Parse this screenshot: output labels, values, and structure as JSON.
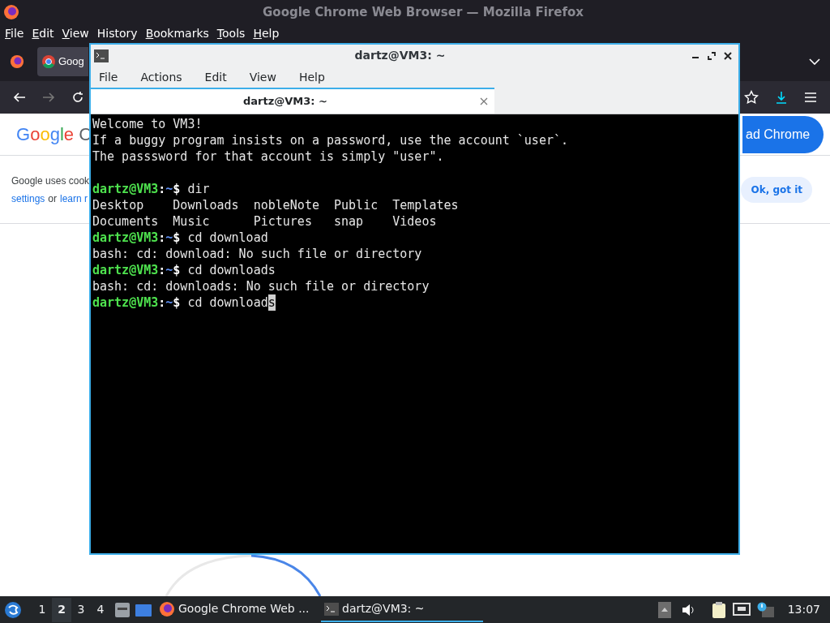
{
  "browser": {
    "title": "Google Chrome Web Browser — Mozilla Firefox",
    "menu": [
      {
        "label": "File",
        "underlined": true
      },
      {
        "label": "Edit",
        "underlined": true
      },
      {
        "label": "View",
        "underlined": true
      },
      {
        "label": "History",
        "underlined": false
      },
      {
        "label": "Bookmarks",
        "underlined": true
      },
      {
        "label": "Tools",
        "underlined": true
      },
      {
        "label": "Help",
        "underlined": true
      }
    ],
    "tab": {
      "title": "Goog"
    },
    "page": {
      "logo": "Google C",
      "cookie_text": "Google uses cook",
      "settings_link": "settings",
      "or": "or",
      "learn_link": "learn r",
      "download_button": "ad Chrome",
      "ok_button": "Ok, got it"
    }
  },
  "terminal": {
    "title": "dartz@VM3: ~",
    "menu": [
      "File",
      "Actions",
      "Edit",
      "View",
      "Help"
    ],
    "tab": {
      "title": "dartz@VM3: ~",
      "selected": true
    },
    "lines": [
      {
        "kind": "output",
        "text": "Welcome to VM3!"
      },
      {
        "kind": "output",
        "text": "If a buggy program insists on a password, use the account `user`."
      },
      {
        "kind": "output",
        "text": "The passsword for that account is simply \"user\"."
      },
      {
        "kind": "blank"
      },
      {
        "kind": "prompt",
        "user": "dartz@VM3",
        "sep": ":",
        "path": "~",
        "sign": "$",
        "command": "dir"
      },
      {
        "kind": "output",
        "text": "Desktop    Downloads  nobleNote  Public  Templates"
      },
      {
        "kind": "output",
        "text": "Documents  Music      Pictures   snap    Videos"
      },
      {
        "kind": "prompt",
        "user": "dartz@VM3",
        "sep": ":",
        "path": "~",
        "sign": "$",
        "command": "cd download"
      },
      {
        "kind": "output",
        "text": "bash: cd: download: No such file or directory"
      },
      {
        "kind": "prompt",
        "user": "dartz@VM3",
        "sep": ":",
        "path": "~",
        "sign": "$",
        "command": "cd downloads"
      },
      {
        "kind": "output",
        "text": "bash: cd: downloads: No such file or directory"
      },
      {
        "kind": "prompt",
        "user": "dartz@VM3",
        "sep": ":",
        "path": "~",
        "sign": "$",
        "command": "cd download",
        "cursor": "s"
      }
    ]
  },
  "taskbar": {
    "workspaces": [
      {
        "label": "1",
        "selected": false
      },
      {
        "label": "2",
        "selected": true
      },
      {
        "label": "3",
        "selected": false
      },
      {
        "label": "4",
        "selected": false
      }
    ],
    "tasks": [
      {
        "kind": "firefox",
        "label": "Google Chrome Web ...",
        "selected": false
      },
      {
        "kind": "terminal",
        "label": "dartz@VM3: ~",
        "selected": true
      }
    ],
    "clock": "13:07"
  }
}
